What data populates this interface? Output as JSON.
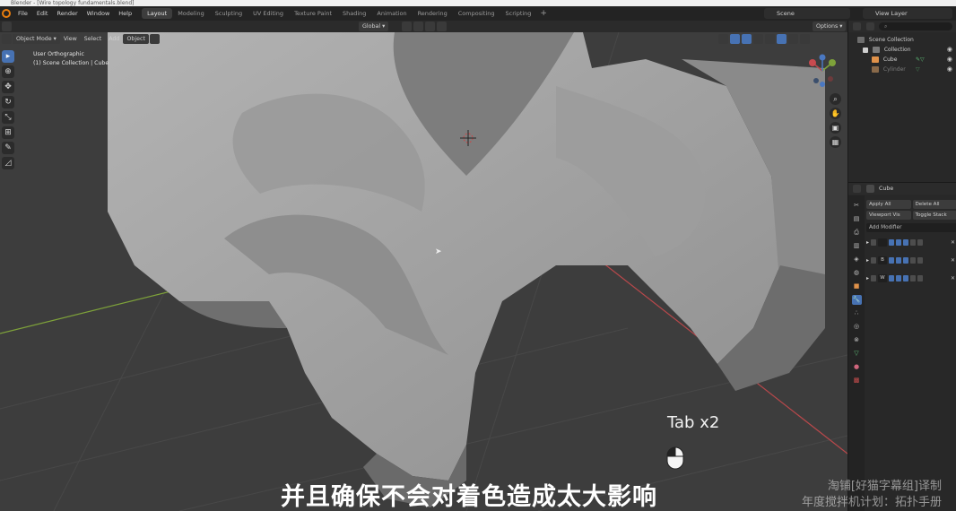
{
  "window": {
    "title": "Blender - [Wire topology fundamentals.blend]"
  },
  "menu": [
    "File",
    "Edit",
    "Render",
    "Window",
    "Help"
  ],
  "workspaces": [
    {
      "label": "Layout",
      "active": true
    },
    {
      "label": "Modeling",
      "active": false
    },
    {
      "label": "Sculpting",
      "active": false
    },
    {
      "label": "UV Editing",
      "active": false
    },
    {
      "label": "Texture Paint",
      "active": false
    },
    {
      "label": "Shading",
      "active": false
    },
    {
      "label": "Animation",
      "active": false
    },
    {
      "label": "Rendering",
      "active": false
    },
    {
      "label": "Compositing",
      "active": false
    },
    {
      "label": "Scripting",
      "active": false
    }
  ],
  "scene": {
    "label": "Scene"
  },
  "view_layer": {
    "label": "View Layer"
  },
  "viewport": {
    "transform_orientation": "Global",
    "options_label": "Options",
    "mode": "Object Mode",
    "header_menus": [
      "View",
      "Select",
      "Add",
      "Object"
    ],
    "view_name": "User Orthographic",
    "collection_info": "(1) Scene Collection | Cube"
  },
  "overlay": {
    "key_hint": "Tab x2",
    "subtitle": "并且确保不会对着色造成太大影响",
    "watermark_line1": "淘铺[好猫字幕组]译制",
    "watermark_line2": "年度搅拌机计划：拓扑手册"
  },
  "outliner": {
    "root": "Scene Collection",
    "collection": "Collection",
    "objects": [
      {
        "name": "Cube",
        "dim": false
      },
      {
        "name": "Cylinder",
        "dim": true
      }
    ]
  },
  "properties": {
    "object_name": "Cube",
    "apply_all": "Apply All",
    "delete_all": "Delete All",
    "viewport_vis": "Viewport Vis",
    "toggle_stack": "Toggle Stack",
    "add_modifier": "Add Modifier",
    "modifiers": [
      {
        "label": ""
      },
      {
        "label": "B"
      },
      {
        "label": "W"
      }
    ]
  },
  "colors": {
    "accent": "#4772b3",
    "viewport_bg": "#3d3d3d",
    "mesh": "#a6a6a6",
    "axis_x": "#b8484b",
    "axis_y": "#7ea23a"
  }
}
